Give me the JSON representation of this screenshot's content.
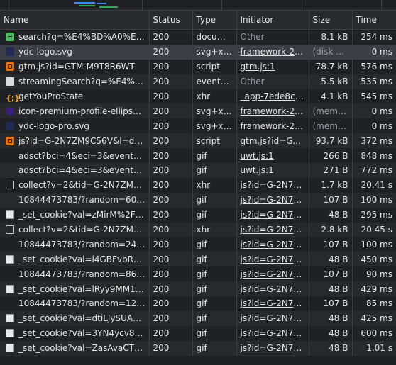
{
  "columns": {
    "name": "Name",
    "status": "Status",
    "type": "Type",
    "initiator": "Initiator",
    "size": "Size",
    "time": "Time"
  },
  "rows": [
    {
      "icon": "document-icon",
      "name": "search?q=%E4%BD%A0%E5...",
      "status": "200",
      "type": "docum...",
      "initiator": "Other",
      "initiator_link": false,
      "size": "8.1 kB",
      "time": "254 ms"
    },
    {
      "icon": "svg-image-icon",
      "name": "ydc-logo.svg",
      "status": "200",
      "type": "svg+xml",
      "initiator": "framework-2f021",
      "initiator_link": true,
      "size": "(disk c...",
      "size_dim": true,
      "time": "0 ms",
      "selected": true
    },
    {
      "icon": "script-icon",
      "name": "gtm.js?id=GTM-M9T8R6WT",
      "status": "200",
      "type": "script",
      "initiator": "gtm.js:1",
      "initiator_link": true,
      "size": "78.7 kB",
      "time": "576 ms"
    },
    {
      "icon": "event-stream-icon",
      "name": "streamingSearch?q=%E4%B...",
      "status": "200",
      "type": "events...",
      "initiator": "Other",
      "initiator_link": false,
      "size": "5.5 kB",
      "time": "535 ms"
    },
    {
      "icon": "xhr-icon",
      "name": "getYouProState",
      "status": "200",
      "type": "xhr",
      "initiator": "_app-7ede8cf011",
      "initiator_link": true,
      "size": "4.1 kB",
      "time": "545 ms"
    },
    {
      "icon": "premium-ellipse-icon",
      "name": "icon-premium-profile-ellipse...",
      "status": "200",
      "type": "svg+xml",
      "initiator": "framework-2f021",
      "initiator_link": true,
      "size": "(memo...",
      "size_dim": true,
      "time": "0 ms"
    },
    {
      "icon": "svg-image-icon",
      "name": "ydc-logo-pro.svg",
      "status": "200",
      "type": "svg+xml",
      "initiator": "framework-2f021",
      "initiator_link": true,
      "size": "(memo...",
      "size_dim": true,
      "time": "0 ms"
    },
    {
      "icon": "script-icon",
      "name": "js?id=G-2N7ZM9C56V&l=da...",
      "status": "200",
      "type": "script",
      "initiator": "gtm.js?id=GTM-M",
      "initiator_link": true,
      "size": "93.7 kB",
      "time": "372 ms"
    },
    {
      "icon": "none",
      "name": "adsct?bci=4&eci=3&event=...",
      "status": "200",
      "type": "gif",
      "initiator": "uwt.js:1",
      "initiator_link": true,
      "size": "266 B",
      "time": "848 ms"
    },
    {
      "icon": "none",
      "name": "adsct?bci=4&eci=3&event=...",
      "status": "200",
      "type": "gif",
      "initiator": "uwt.js:1",
      "initiator_link": true,
      "size": "271 B",
      "time": "772 ms"
    },
    {
      "icon": "file-icon",
      "name": "collect?v=2&tid=G-2N7ZM9...",
      "status": "200",
      "type": "xhr",
      "initiator": "js?id=G-2N7ZM9",
      "initiator_link": true,
      "size": "1.7 kB",
      "time": "20.41 s"
    },
    {
      "icon": "none",
      "name": "10844473783/?random=601...",
      "status": "200",
      "type": "gif",
      "initiator": "js?id=G-2N7ZM9",
      "initiator_link": true,
      "size": "107 B",
      "time": "100 ms"
    },
    {
      "icon": "gif-image-icon",
      "name": "_set_cookie?val=zMirM%2FB...",
      "status": "200",
      "type": "gif",
      "initiator": "js?id=G-2N7ZM9",
      "initiator_link": true,
      "size": "48 B",
      "time": "295 ms"
    },
    {
      "icon": "file-icon",
      "name": "collect?v=2&tid=G-2N7ZM9...",
      "status": "200",
      "type": "xhr",
      "initiator": "js?id=G-2N7ZM9",
      "initiator_link": true,
      "size": "2.8 kB",
      "time": "20.45 s"
    },
    {
      "icon": "none",
      "name": "10844473783/?random=240...",
      "status": "200",
      "type": "gif",
      "initiator": "js?id=G-2N7ZM9",
      "initiator_link": true,
      "size": "107 B",
      "time": "100 ms"
    },
    {
      "icon": "gif-image-icon",
      "name": "_set_cookie?val=l4GBFvbRSz...",
      "status": "200",
      "type": "gif",
      "initiator": "js?id=G-2N7ZM9",
      "initiator_link": true,
      "size": "48 B",
      "time": "450 ms"
    },
    {
      "icon": "none",
      "name": "10844473783/?random=863...",
      "status": "200",
      "type": "gif",
      "initiator": "js?id=G-2N7ZM9",
      "initiator_link": true,
      "size": "107 B",
      "time": "90 ms"
    },
    {
      "icon": "gif-image-icon",
      "name": "_set_cookie?val=lRyy9MM1N...",
      "status": "200",
      "type": "gif",
      "initiator": "js?id=G-2N7ZM9",
      "initiator_link": true,
      "size": "48 B",
      "time": "429 ms"
    },
    {
      "icon": "none",
      "name": "10844473783/?random=125...",
      "status": "200",
      "type": "gif",
      "initiator": "js?id=G-2N7ZM9",
      "initiator_link": true,
      "size": "107 B",
      "time": "85 ms"
    },
    {
      "icon": "gif-image-icon",
      "name": "_set_cookie?val=dtiLJySUA7h...",
      "status": "200",
      "type": "gif",
      "initiator": "js?id=G-2N7ZM9",
      "initiator_link": true,
      "size": "48 B",
      "time": "425 ms"
    },
    {
      "icon": "gif-image-icon",
      "name": "_set_cookie?val=3YN4ycv8x...",
      "status": "200",
      "type": "gif",
      "initiator": "js?id=G-2N7ZM9",
      "initiator_link": true,
      "size": "48 B",
      "time": "600 ms"
    },
    {
      "icon": "gif-image-icon",
      "name": "_set_cookie?val=ZasAvaCT1T...",
      "status": "200",
      "type": "gif",
      "initiator": "js?id=G-2N7ZM9",
      "initiator_link": true,
      "size": "48 B",
      "time": "1.01 s"
    }
  ],
  "colors": {
    "background": "#202124",
    "header": "#282a2d",
    "selected_row": "#3b3f45",
    "dim_text": "#9aa0a6",
    "waterfall_green": "#34a853",
    "waterfall_blue": "#4285f4"
  }
}
